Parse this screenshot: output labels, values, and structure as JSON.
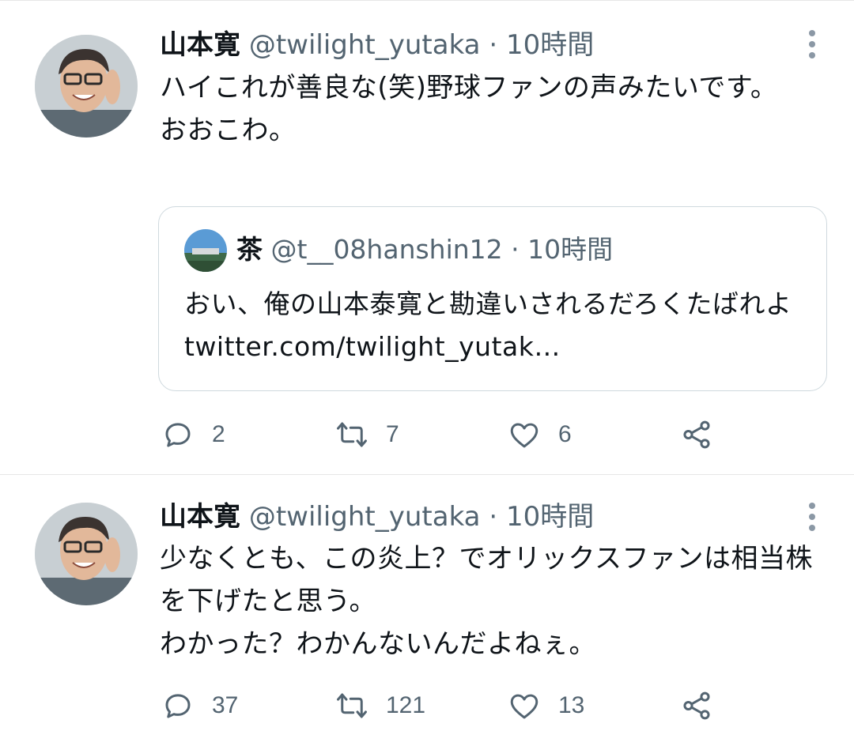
{
  "colors": {
    "text": "#0f1419",
    "secondary": "#536471",
    "border": "#cfd9de",
    "divider": "#e6e6e6"
  },
  "tweets": [
    {
      "name": "山本寛",
      "handle": "@twilight_yutaka",
      "separator": "·",
      "time": "10時間",
      "text": "ハイこれが善良な(笑)野球ファンの声みたいです。\nおおこわ。",
      "quoted": {
        "name": "茶",
        "handle": "@t__08hanshin12",
        "separator": "·",
        "time": "10時間",
        "text": "おい、俺の山本泰寛と勘違いされるだろくたばれよ twitter.com/twilight_yutak…"
      },
      "replies": "2",
      "retweets": "7",
      "likes": "6"
    },
    {
      "name": "山本寛",
      "handle": "@twilight_yutaka",
      "separator": "·",
      "time": "10時間",
      "text": "少なくとも、この炎上？でオリックスファンは相当株を下げたと思う。\nわかった？わかんないんだよねぇ。",
      "replies": "37",
      "retweets": "121",
      "likes": "13"
    }
  ],
  "icons": [
    "more-icon",
    "reply-icon",
    "retweet-icon",
    "like-icon",
    "share-icon"
  ]
}
